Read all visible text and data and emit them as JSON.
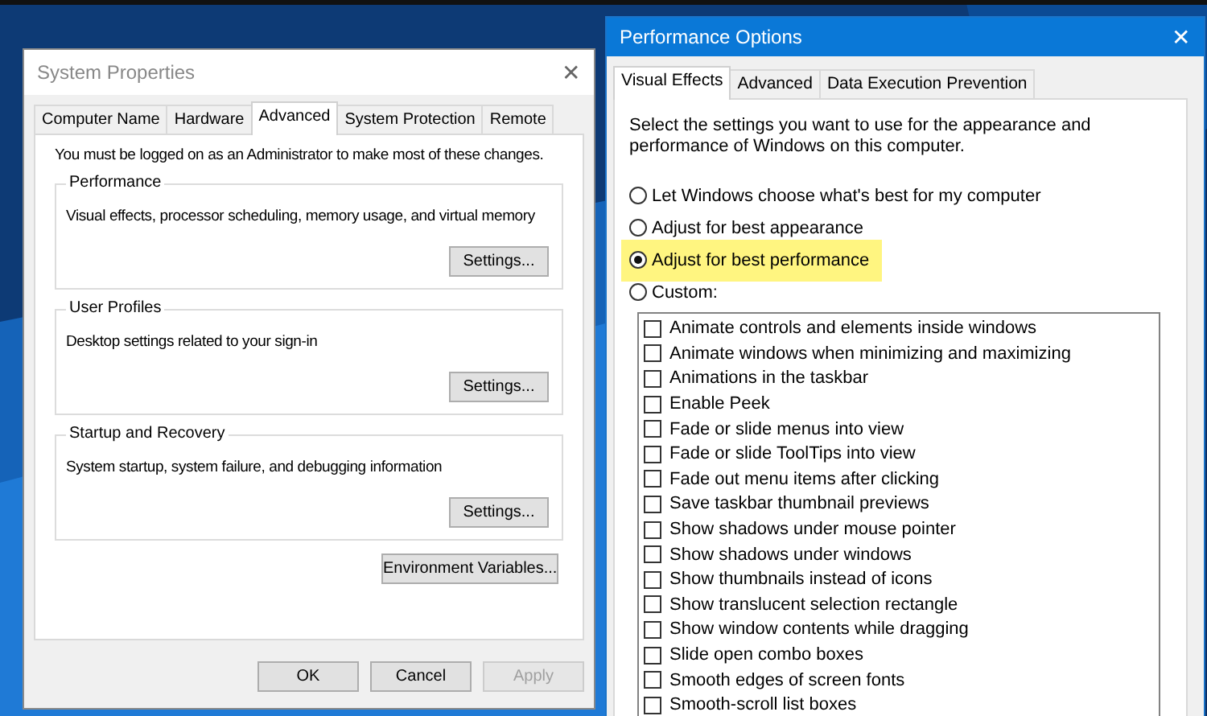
{
  "system_properties": {
    "title": "System Properties",
    "close": "✕",
    "tabs": [
      {
        "label": "Computer Name",
        "selected": false
      },
      {
        "label": "Hardware",
        "selected": false
      },
      {
        "label": "Advanced",
        "selected": true
      },
      {
        "label": "System Protection",
        "selected": false
      },
      {
        "label": "Remote",
        "selected": false
      }
    ],
    "notice": "You must be logged on as an Administrator to make most of these changes.",
    "groups": [
      {
        "title": "Performance",
        "description": "Visual effects, processor scheduling, memory usage, and virtual memory",
        "button": "Settings..."
      },
      {
        "title": "User Profiles",
        "description": "Desktop settings related to your sign-in",
        "button": "Settings..."
      },
      {
        "title": "Startup and Recovery",
        "description": "System startup, system failure, and debugging information",
        "button": "Settings..."
      }
    ],
    "environment_button": "Environment Variables...",
    "buttons": [
      {
        "label": "OK",
        "disabled": false
      },
      {
        "label": "Cancel",
        "disabled": false
      },
      {
        "label": "Apply",
        "disabled": true
      }
    ]
  },
  "performance_options": {
    "title": "Performance Options",
    "close": "✕",
    "tabs": [
      {
        "label": "Visual Effects",
        "selected": true
      },
      {
        "label": "Advanced",
        "selected": false
      },
      {
        "label": "Data Execution Prevention",
        "selected": false
      }
    ],
    "intro": "Select the settings you want to use for the appearance and performance of Windows on this computer.",
    "options": [
      {
        "label": "Let Windows choose what's best for my computer",
        "selected": false,
        "highlighted": false
      },
      {
        "label": "Adjust for best appearance",
        "selected": false,
        "highlighted": false
      },
      {
        "label": "Adjust for best performance",
        "selected": true,
        "highlighted": true
      },
      {
        "label": "Custom:",
        "selected": false,
        "highlighted": false
      }
    ],
    "effects": [
      {
        "label": "Animate controls and elements inside windows",
        "checked": false
      },
      {
        "label": "Animate windows when minimizing and maximizing",
        "checked": false
      },
      {
        "label": "Animations in the taskbar",
        "checked": false
      },
      {
        "label": "Enable Peek",
        "checked": false
      },
      {
        "label": "Fade or slide menus into view",
        "checked": false
      },
      {
        "label": "Fade or slide ToolTips into view",
        "checked": false
      },
      {
        "label": "Fade out menu items after clicking",
        "checked": false
      },
      {
        "label": "Save taskbar thumbnail previews",
        "checked": false
      },
      {
        "label": "Show shadows under mouse pointer",
        "checked": false
      },
      {
        "label": "Show shadows under windows",
        "checked": false
      },
      {
        "label": "Show thumbnails instead of icons",
        "checked": false
      },
      {
        "label": "Show translucent selection rectangle",
        "checked": false
      },
      {
        "label": "Show window contents while dragging",
        "checked": false
      },
      {
        "label": "Slide open combo boxes",
        "checked": false
      },
      {
        "label": "Smooth edges of screen fonts",
        "checked": false
      },
      {
        "label": "Smooth-scroll list boxes",
        "checked": false
      }
    ]
  }
}
